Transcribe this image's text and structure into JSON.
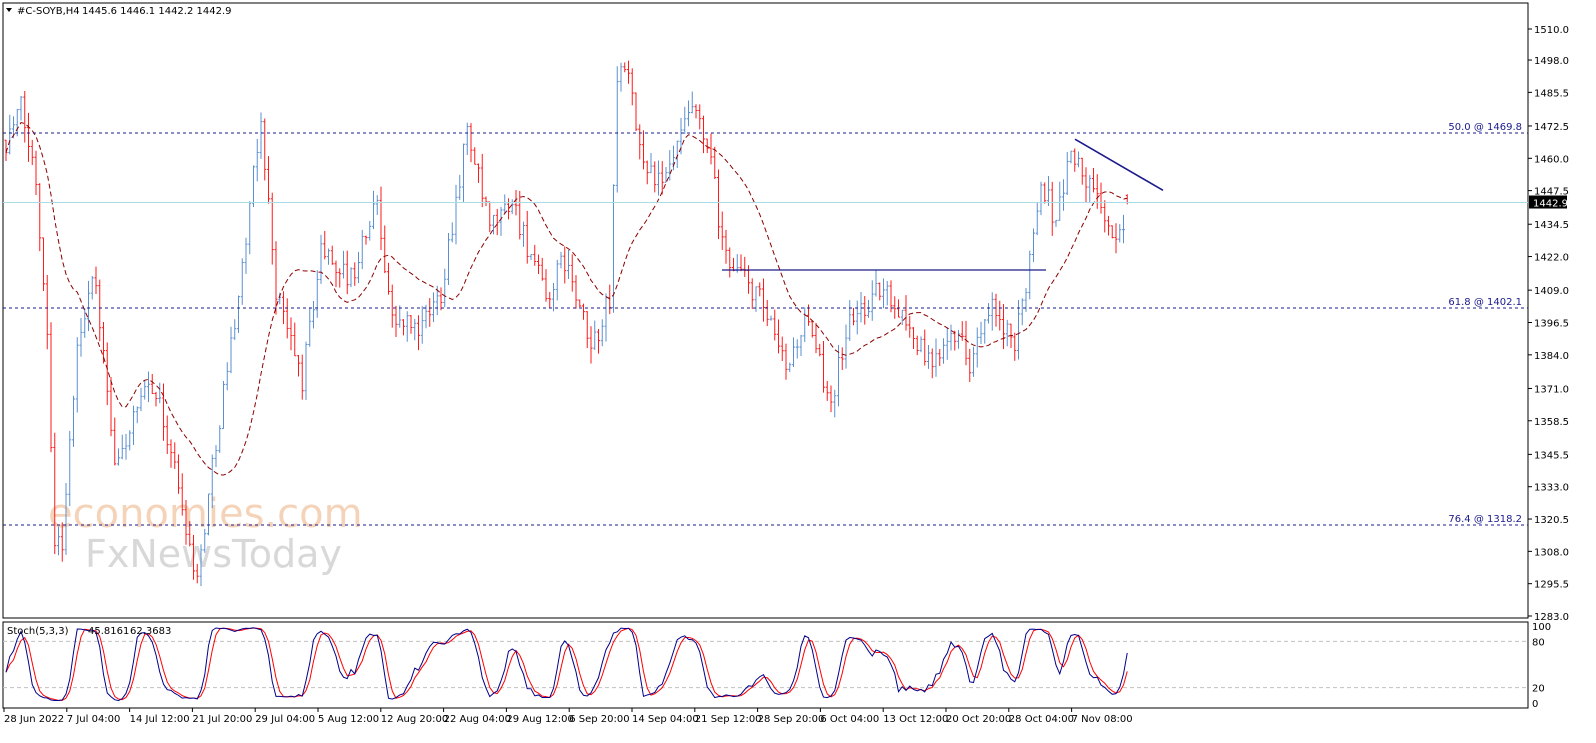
{
  "header": {
    "symbol": "#C-SOYB,H4",
    "ohlc": "1445.6 1446.1 1442.2 1442.9"
  },
  "watermark": {
    "line1": "economies.com",
    "line2": "FxNewsToday"
  },
  "colors": {
    "up": "#5b8fd0",
    "down": "#ff1a1a",
    "ma": "#8b0000",
    "fib": "#1a1a8c",
    "trend": "#1a1a8c",
    "current": "#a8dde6",
    "stoch_main": "#00008b",
    "stoch_signal": "#ff0000"
  },
  "chart_data": {
    "type": "ohlc",
    "title": "#C-SOYB,H4",
    "price_ticks": [
      "1510.0",
      "1498.0",
      "1485.5",
      "1472.5",
      "1460.0",
      "1447.5",
      "1434.5",
      "1422.0",
      "1409.0",
      "1396.5",
      "1384.0",
      "1371.0",
      "1358.5",
      "1345.5",
      "1333.0",
      "1320.5",
      "1308.0",
      "1295.5",
      "1283.0"
    ],
    "ylim": [
      1283.0,
      1510.0
    ],
    "current_price": {
      "value": 1442.9,
      "label": "1442.9"
    },
    "x_labels": [
      "28 Jun 2022",
      "7 Jul 04:00",
      "14 Jul 12:00",
      "21 Jul 20:00",
      "29 Jul 04:00",
      "5 Aug 12:00",
      "12 Aug 20:00",
      "22 Aug 04:00",
      "29 Aug 12:00",
      "6 Sep 20:00",
      "14 Sep 04:00",
      "21 Sep 12:00",
      "28 Sep 20:00",
      "6 Oct 04:00",
      "13 Oct 12:00",
      "20 Oct 20:00",
      "28 Oct 04:00",
      "7 Nov 08:00"
    ],
    "bars": 300,
    "price_path": [
      [
        0,
        1467
      ],
      [
        4,
        1479
      ],
      [
        8,
        1452
      ],
      [
        11,
        1394
      ],
      [
        13,
        1312
      ],
      [
        15,
        1312
      ],
      [
        19,
        1386
      ],
      [
        23,
        1417
      ],
      [
        25,
        1397
      ],
      [
        29,
        1339
      ],
      [
        33,
        1355
      ],
      [
        39,
        1374
      ],
      [
        44,
        1347
      ],
      [
        51,
        1297
      ],
      [
        56,
        1351
      ],
      [
        63,
        1417
      ],
      [
        68,
        1475
      ],
      [
        72,
        1409
      ],
      [
        79,
        1374
      ],
      [
        84,
        1425
      ],
      [
        92,
        1413
      ],
      [
        99,
        1444
      ],
      [
        103,
        1397
      ],
      [
        111,
        1394
      ],
      [
        116,
        1409
      ],
      [
        123,
        1471
      ],
      [
        129,
        1432
      ],
      [
        135,
        1444
      ],
      [
        144,
        1405
      ],
      [
        149,
        1421
      ],
      [
        156,
        1386
      ],
      [
        161,
        1405
      ],
      [
        163,
        1490
      ],
      [
        165,
        1498
      ],
      [
        169,
        1463
      ],
      [
        175,
        1448
      ],
      [
        183,
        1479
      ],
      [
        188,
        1459
      ],
      [
        191,
        1425
      ],
      [
        201,
        1405
      ],
      [
        208,
        1378
      ],
      [
        213,
        1397
      ],
      [
        220,
        1367
      ],
      [
        225,
        1397
      ],
      [
        233,
        1409
      ],
      [
        237,
        1405
      ],
      [
        247,
        1378
      ],
      [
        252,
        1397
      ],
      [
        257,
        1382
      ],
      [
        263,
        1401
      ],
      [
        269,
        1386
      ],
      [
        272,
        1413
      ],
      [
        276,
        1452
      ],
      [
        280,
        1436
      ],
      [
        284,
        1463
      ],
      [
        289,
        1448
      ],
      [
        292,
        1444
      ],
      [
        295,
        1425
      ],
      [
        300,
        1443
      ]
    ],
    "fibonacci": [
      {
        "level": "50.0",
        "price": 1469.8,
        "label": "50.0 @ 1469.8"
      },
      {
        "level": "61.8",
        "price": 1402.1,
        "label": "61.8 @ 1402.1"
      },
      {
        "level": "76.4",
        "price": 1318.2,
        "label": "76.4 @ 1318.2"
      }
    ],
    "resistance_line": {
      "price": 1416.8
    },
    "trendline": {
      "start_price": 1467.4,
      "end_price": 1447.6
    },
    "indicator": {
      "name": "Stoch(5,3,3)",
      "main": "45.8161",
      "signal": "62.3683",
      "levels": [
        "100",
        "80",
        "20",
        "0"
      ],
      "ylim": [
        0,
        100
      ]
    }
  }
}
